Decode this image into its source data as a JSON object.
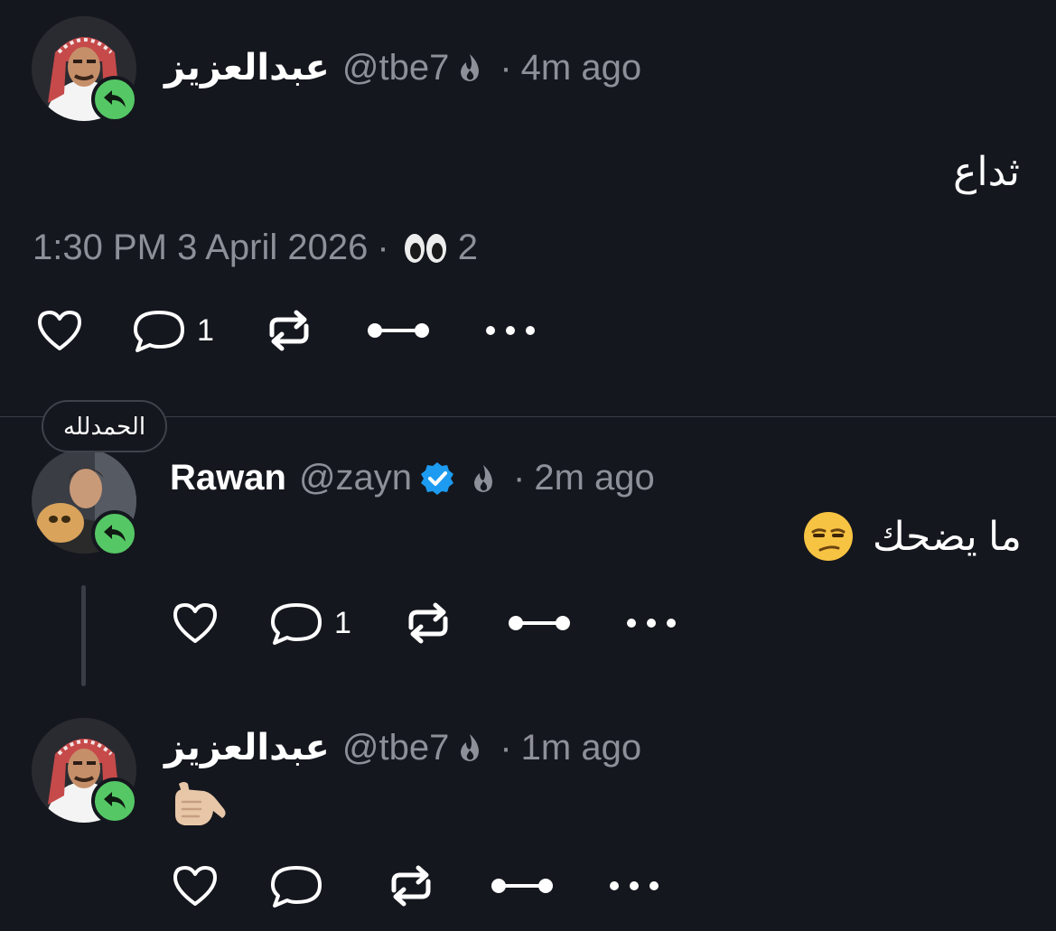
{
  "posts": [
    {
      "name": "عبدالعزيز",
      "handle": "@tbe7",
      "separator": "·",
      "time_ago": "4m ago",
      "text": "ثداع",
      "timestamp": "1:30 PM 3 April 2026",
      "views_separator": "·",
      "views": "2",
      "reply_count": "1",
      "icons": [
        "fire-icon",
        "eyes-icon",
        "heart-icon",
        "comment-icon",
        "repost-icon",
        "link-icon",
        "more-icon",
        "reply-badge-icon"
      ]
    },
    {
      "tag": "الحمدلله",
      "name": "Rawan",
      "handle": "@zayn",
      "separator": "·",
      "time_ago": "2m ago",
      "text": "ما يضحك",
      "reply_count": "1",
      "verified": true,
      "icons": [
        "verified-icon",
        "fire-icon",
        "unamused-face-emoji",
        "heart-icon",
        "comment-icon",
        "repost-icon",
        "link-icon",
        "more-icon",
        "reply-badge-icon"
      ]
    },
    {
      "name": "عبدالعزيز",
      "handle": "@tbe7",
      "separator": "·",
      "time_ago": "1m ago",
      "reply_count": "",
      "icons": [
        "call-me-hand-emoji",
        "fire-icon",
        "heart-icon",
        "comment-icon",
        "repost-icon",
        "link-icon",
        "more-icon",
        "reply-badge-icon"
      ]
    }
  ],
  "colors": {
    "background": "#15171e",
    "text": "#ffffff",
    "muted": "#8e9099",
    "reply_badge": "#55c865",
    "verified": "#1d9bf0"
  }
}
